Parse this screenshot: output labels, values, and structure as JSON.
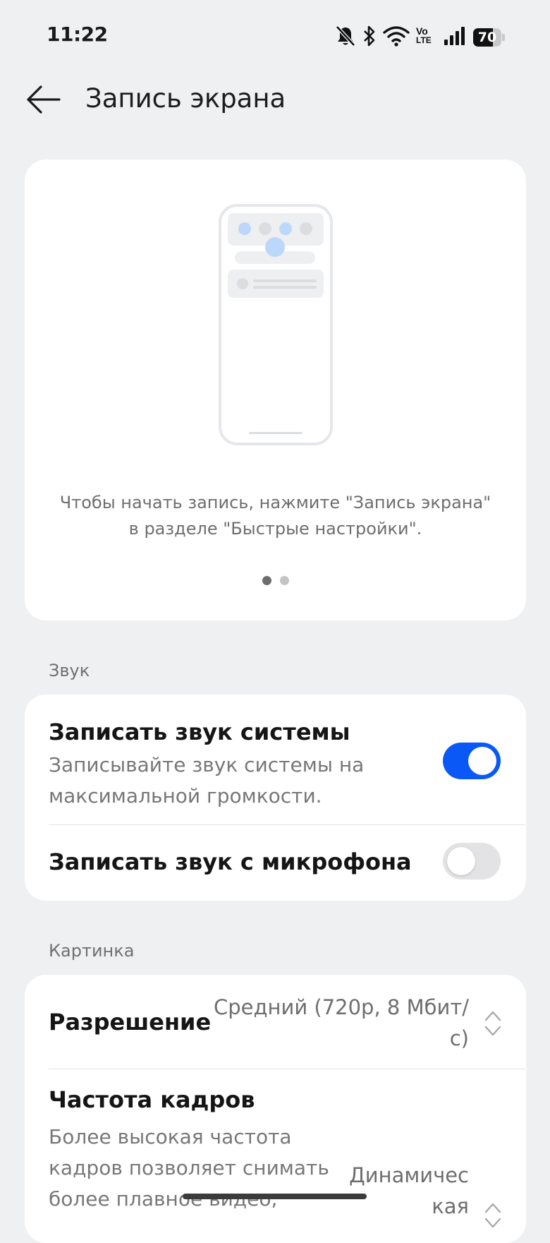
{
  "status_bar": {
    "time": "11:22",
    "battery": "70",
    "battery_level": 0.7,
    "icons": [
      "bell-muted-icon",
      "bluetooth-icon",
      "wifi-icon",
      "volte-icon",
      "signal-icon",
      "battery-icon"
    ],
    "volte_top": "Vo",
    "volte_bottom": "LTE"
  },
  "header": {
    "title": "Запись экрана",
    "back_icon": "arrow-left-icon"
  },
  "illustration": {
    "hint": "Чтобы начать запись, нажмите \"Запись экрана\" в разделе \"Быстрые настройки\".",
    "pages": 2,
    "active_page": 1
  },
  "sound": {
    "section_label": "Звук",
    "system": {
      "title": "Записать звук системы",
      "subtitle": "Записывайте звук системы на максимальной громкости.",
      "enabled": true
    },
    "mic": {
      "title": "Записать звук с микрофона",
      "enabled": false
    }
  },
  "picture": {
    "section_label": "Картинка",
    "resolution": {
      "title": "Разрешение",
      "value_line1": "Средний (720p, 8 Мбит/",
      "value_line2": "с)"
    },
    "framerate": {
      "title": "Частота кадров",
      "subtitle_line1": "Более высокая частота",
      "subtitle_line2": "кадров позволяет снимать",
      "subtitle_line3": "более плавное видео,",
      "value_line1": "Динамичес",
      "value_line2": "кая"
    }
  },
  "colors": {
    "background": "#eff0f2",
    "card": "#ffffff",
    "accent": "#0a59f7",
    "toggle_off": "#e3e3e5"
  }
}
